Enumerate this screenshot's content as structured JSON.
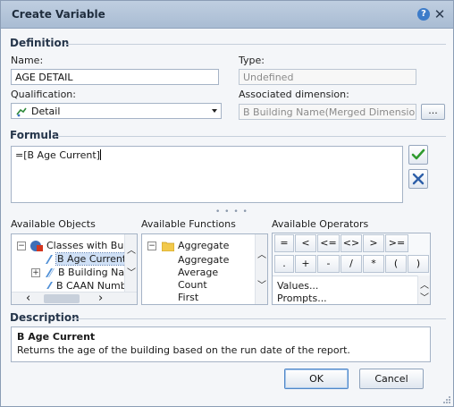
{
  "window": {
    "title": "Create Variable"
  },
  "definition": {
    "section": "Definition",
    "name_label": "Name:",
    "name_value": "AGE DETAIL",
    "type_label": "Type:",
    "type_placeholder": "Undefined",
    "qualification_label": "Qualification:",
    "qualification_value": "Detail",
    "assoc_label": "Associated dimension:",
    "assoc_value": "B Building Name(Merged Dimensions)",
    "browse_label": "..."
  },
  "formula": {
    "section": "Formula",
    "text": "=[B Age Current]"
  },
  "objects": {
    "header": "Available Objects",
    "items": [
      "Classes with Build",
      "B Age Current",
      "B Building Nar",
      "B CAAN Numb"
    ]
  },
  "functions": {
    "header": "Available Functions",
    "items": [
      "Aggregate",
      "Aggregate",
      "Average",
      "Count",
      "First"
    ]
  },
  "operators": {
    "header": "Available Operators",
    "row1": [
      "=",
      "<",
      "<=",
      "<>",
      ">",
      ">="
    ],
    "row2": [
      ".",
      "+",
      "-",
      "/",
      "*",
      "(",
      ")"
    ],
    "extra": [
      "Values...",
      "Prompts..."
    ]
  },
  "description": {
    "section": "Description",
    "title": "B Age Current",
    "text": "Returns the age of the building based on the run date of the report."
  },
  "buttons": {
    "ok": "OK",
    "cancel": "Cancel"
  },
  "colors": {
    "titlebar": "#a9bcd3",
    "accent": "#4f87c8",
    "validate": "#2e9a2e",
    "cancel": "#2d5fa8"
  }
}
